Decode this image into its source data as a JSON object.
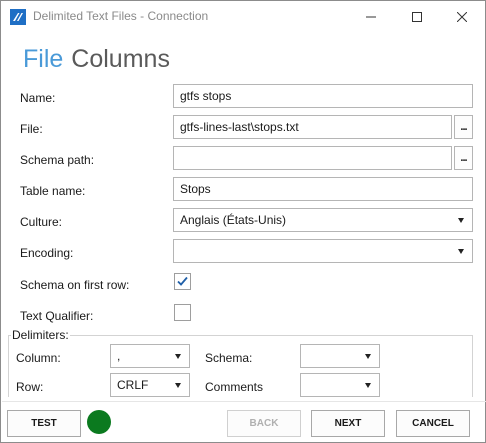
{
  "window": {
    "title": "Delimited Text Files - Connection",
    "controls": {
      "minimize": "minimize-icon",
      "maximize": "maximize-icon",
      "close": "close-icon"
    }
  },
  "tabs": [
    {
      "label": "File",
      "active": true
    },
    {
      "label": "Columns",
      "active": false
    }
  ],
  "form": {
    "name": {
      "label": "Name:",
      "value": "gtfs stops"
    },
    "file": {
      "label": "File:",
      "value": "gtfs-lines-last\\stops.txt",
      "browse": "..."
    },
    "schema_path": {
      "label": "Schema path:",
      "value": "",
      "browse": "..."
    },
    "table_name": {
      "label": "Table name:",
      "value": "Stops"
    },
    "culture": {
      "label": "Culture:",
      "value": "Anglais (États-Unis)"
    },
    "encoding": {
      "label": "Encoding:",
      "value": ""
    },
    "schema_first_row": {
      "label": "Schema on first row:",
      "checked": true
    },
    "text_qualifier": {
      "label": "Text Qualifier:",
      "checked": false
    }
  },
  "delimiters": {
    "title": "Delimiters:",
    "column": {
      "label": "Column:",
      "value": ","
    },
    "row": {
      "label": "Row:",
      "value": "CRLF"
    },
    "schema": {
      "label": "Schema:",
      "value": ""
    },
    "comments": {
      "label": "Comments",
      "value": ""
    }
  },
  "footer": {
    "test": "TEST",
    "back": "BACK",
    "next": "NEXT",
    "cancel": "CANCEL",
    "status_color": "#0b7a1f"
  },
  "colors": {
    "accent": "#4a9ad8",
    "check": "#1f5fa8"
  }
}
